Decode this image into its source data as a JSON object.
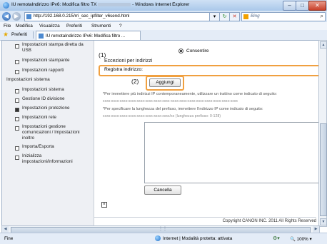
{
  "window": {
    "title_prefix": "IU remotaIndirizzo IPv6: Modifica filtro TX",
    "title_suffix": "- Windows Internet Explorer",
    "btn_min": "–",
    "btn_max": "□",
    "btn_close": "✕"
  },
  "address": {
    "url": "http://192.168.0.215/rri_sec_ipfilter_v6send.html",
    "search_placeholder": "Bing"
  },
  "menu": [
    "File",
    "Modifica",
    "Visualizza",
    "Preferiti",
    "Strumenti",
    "?"
  ],
  "favorites": {
    "label": "Preferiti",
    "tab_title": "IU remotaIndirizzo IPv6: Modifica filtro"
  },
  "sidebar": {
    "items_top": [
      {
        "label": "Impostazioni stampa diretta da USB"
      },
      {
        "label": "Impostazioni stampante"
      },
      {
        "label": "Impostazioni rapporti"
      }
    ],
    "section": "Impostazioni sistema",
    "items": [
      {
        "label": "Impostazioni sistema",
        "selected": false
      },
      {
        "label": "Gestione ID divisione",
        "selected": false
      },
      {
        "label": "Impostazioni protezione",
        "selected": true
      },
      {
        "label": "Impostazioni rete",
        "selected": false
      },
      {
        "label": "Impostazioni gestione comunicazioni / Impostazioni inoltro",
        "selected": false
      },
      {
        "label": "Importa/Esporta",
        "selected": false
      },
      {
        "label": "Inizializza impostazioni/informazioni",
        "selected": false
      }
    ]
  },
  "main": {
    "policy_value": "Consentire",
    "callout1": "(1)",
    "callout2": "(2)",
    "section_title": "Eccezioni per indirizzi",
    "register_label": "Registra indirizzo:",
    "add_button": "Aggiungi",
    "note1": "*Per immettere più indirizzi IP contemporaneamente, utilizzare un trattino come indicato di seguito:",
    "note1_format": "xxxx:xxxx:xxxx:xxxx:xxxx:xxxx:xxxx:xxxx-xxxx:xxxx:xxxx:xxxx:xxxx:xxxx:xxxx:xxxx",
    "note2": "*Per specificare la lunghezza del prefisso, immettere l'indirizzo IP come indicato di seguito:",
    "note2_format": "xxxx:xxxx:xxxx:xxxx:xxxx:xxxx:xxxx:xxxx/xx (lunghezza prefisso: 0-128)",
    "delete_button": "Cancella",
    "copyright": "Copyright CANON INC. 2011 All Rights Reserved"
  },
  "status": {
    "left": "Fine",
    "zone": "Internet | Modalità protetta: attivata",
    "zoom": "100%"
  }
}
